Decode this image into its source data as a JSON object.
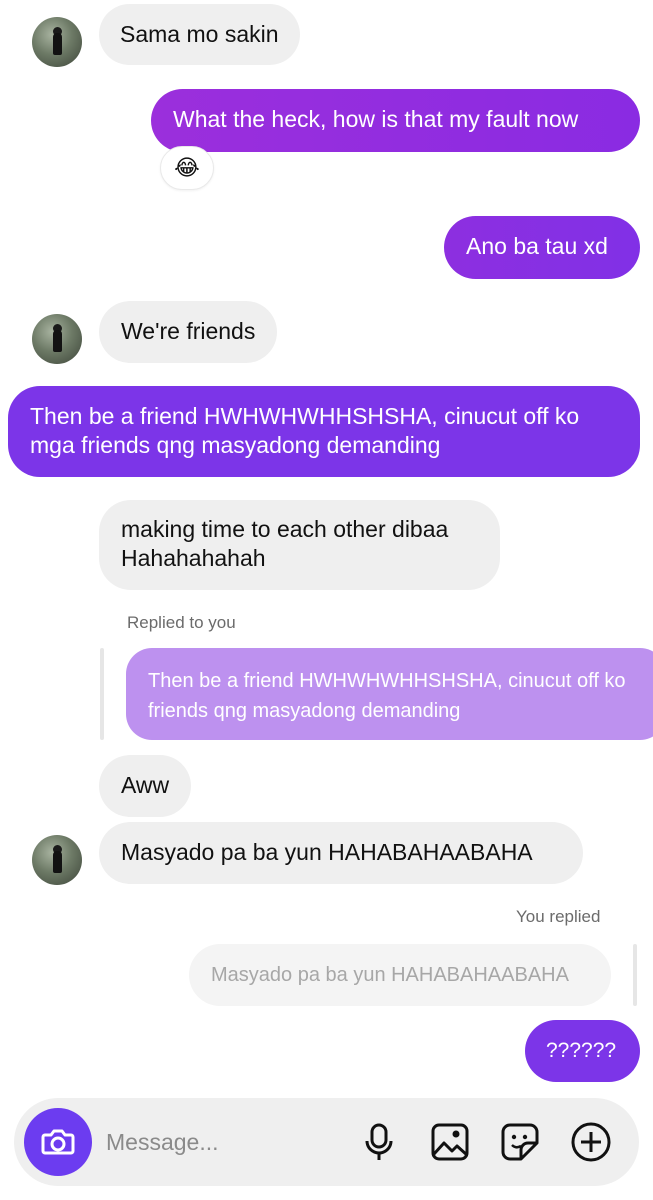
{
  "messages": [
    {
      "text": "Sama mo sakin"
    },
    {
      "text": "What the heck, how is that my fault now"
    },
    {
      "text": "Ano ba tau xd"
    },
    {
      "text": "We're friends"
    },
    {
      "line1": "Then be a friend HWHWHWHHSHSHA, cinucut off ko",
      "line2": "mga friends qng masyadong demanding"
    },
    {
      "line1": "making time to each other dibaa",
      "line2": "Hahahahahah"
    },
    {
      "text": "Aww"
    },
    {
      "text": "Masyado pa ba yun HAHABAHAABAHA"
    },
    {
      "text": "??????"
    }
  ],
  "reaction": {
    "emoji": "😂"
  },
  "replied_to_you": {
    "label": "Replied to you",
    "quote_line1": "Then be a friend HWHWHWHHSHSHA, cinucut off ko",
    "quote_line2": "friends qng masyadong demanding"
  },
  "you_replied": {
    "label": "You replied",
    "quote": "Masyado pa ba yun HAHABAHAABAHA"
  },
  "composer": {
    "placeholder": "Message...",
    "camera_icon": "camera-icon",
    "tools": [
      "microphone-icon",
      "gallery-icon",
      "sticker-icon",
      "plus-icon"
    ]
  },
  "colors": {
    "outgoing": "#9b2fdc",
    "outgoing_alt": "#7c35e8",
    "incoming": "#efefef",
    "camera": "#6c3cf0"
  }
}
